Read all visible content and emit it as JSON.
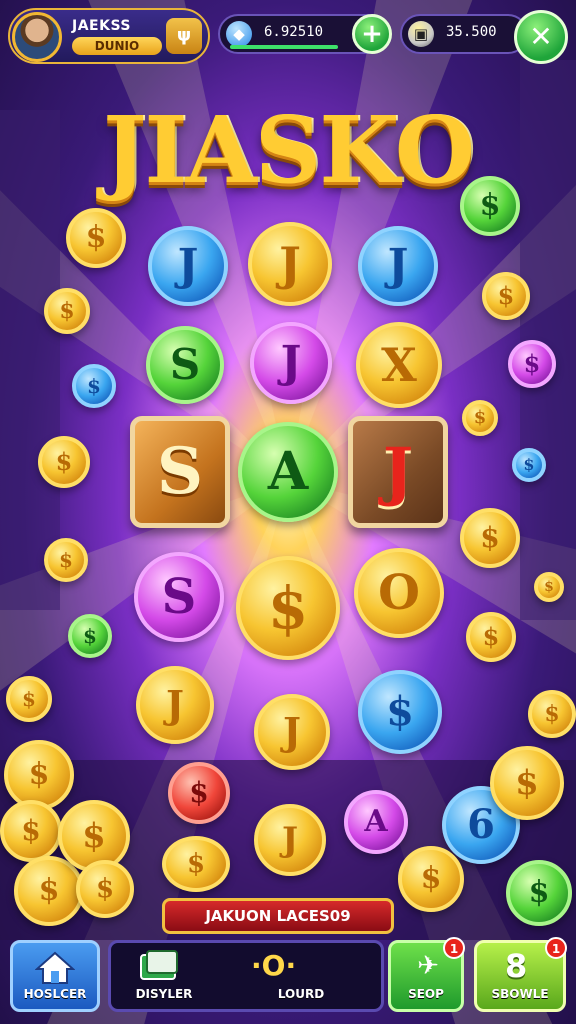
{
  "profile": {
    "name": "JAEKSS",
    "subtitle": "DUNIO",
    "badge_icon": "ψ"
  },
  "currency_gems": {
    "value": "6.92510",
    "add_label": "+",
    "icon": "gem-icon",
    "progress": 0.55
  },
  "currency_coins": {
    "value": "35.500",
    "icon": "coin-icon",
    "progress": 0.0
  },
  "close_label": "✕",
  "logo_text": "JIASKO",
  "grid_coins": {
    "r1c1": "J",
    "r1c2": "J",
    "r1c3": "J",
    "r2c1": "S",
    "r2c2": "J",
    "r2c3": "X",
    "tile_left": "S",
    "center": "A",
    "tile_right": "J",
    "r4c1": "S",
    "r4c2": "$",
    "r4c3": "O"
  },
  "scatter_coins": {
    "a": "$",
    "b": "$",
    "c": "$",
    "d": "$",
    "e": "$",
    "f": "$",
    "g": "$",
    "h": "$",
    "i": "J",
    "j": "J",
    "k": "$",
    "l": "$",
    "m": "A",
    "n": "6",
    "o": "$",
    "p": "$",
    "q": "$",
    "r": "$",
    "s": "$",
    "t": "$"
  },
  "jackpot_text": "JAKUON LACES09",
  "nav": {
    "home_label": "HOSLCER",
    "display_label": "DISYLER",
    "lound_value": "·O·",
    "lound_label": "LOURD",
    "shop_label": "SEOP",
    "shop_badge": "1",
    "store_label": "SBOWLE",
    "store_badge": "1",
    "store_glyph": "8"
  },
  "colors": {
    "accent_gold": "#f7c531",
    "bg_purple": "#3a1a78",
    "btn_green": "#1fa53a",
    "btn_blue": "#2a70d8"
  }
}
